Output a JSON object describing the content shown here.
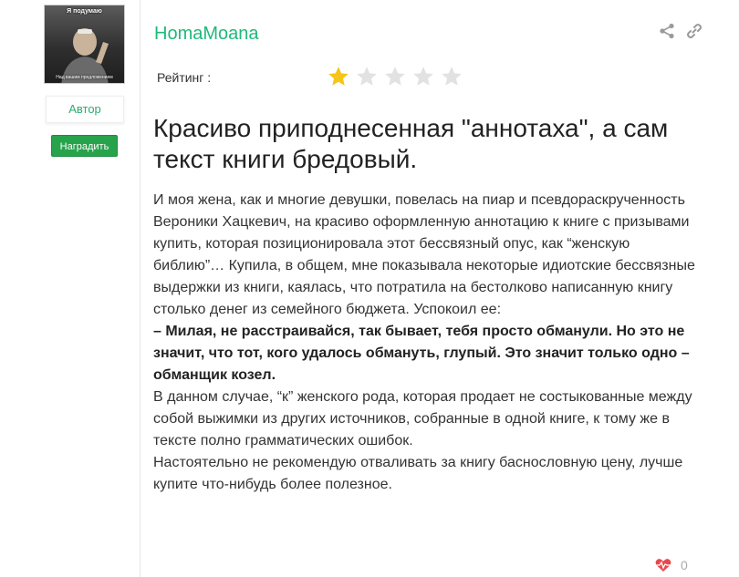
{
  "sidebar": {
    "avatar": {
      "caption_top": "Я подумаю",
      "caption_bottom": "Над вашим предложением"
    },
    "author_badge": "Автор",
    "reward_label": "Наградить"
  },
  "review": {
    "username": "HomaMoana",
    "rating_label": "Рейтинг :",
    "rating": {
      "value": 1,
      "max": 5
    },
    "title": "Красиво приподнесенная \"аннотаха\", а сам текст книги бредовый.",
    "paragraphs": [
      "И моя жена, как и многие девушки, повелась на пиар и псевдораскрученность Вероники Хацкевич, на красиво оформленную аннотацию к книге с призывами купить, которая позиционировала этот бессвязный опус, как “женскую библию”… Купила, в общем, мне показывала некоторые идиотские бессвязные выдержки из книги, каялась, что потратила на бестолково написанную книгу столько денег из семейного бюджета. Успокоил ее:",
      "– Милая, не расстраивайся, так бывает, тебя просто обманули. Но это не значит, что тот, кого удалось обмануть, глупый. Это значит только одно – обманщик козел.",
      "В данном случае, “к” женского рода, которая продает не состыкованные между собой выжимки из других источников, собранные в одной книге, к тому же в тексте полно грамматических ошибок.",
      "Настоятельно не рекомендую отваливать за книгу баснословную цену, лучше купите что-нибудь более полезное."
    ],
    "likes": "0"
  },
  "icons": {
    "share": "share-icon",
    "link": "link-icon",
    "star_filled": "star-filled-icon",
    "star_empty": "star-empty-icon",
    "heart": "heart-pulse-icon"
  },
  "colors": {
    "username": "#1fb97b",
    "author_badge_text": "#2dab6f",
    "reward_button": "#27a34b",
    "star_filled": "#f5c518",
    "star_empty": "#e2e2e2",
    "heart": "#e8474c"
  }
}
